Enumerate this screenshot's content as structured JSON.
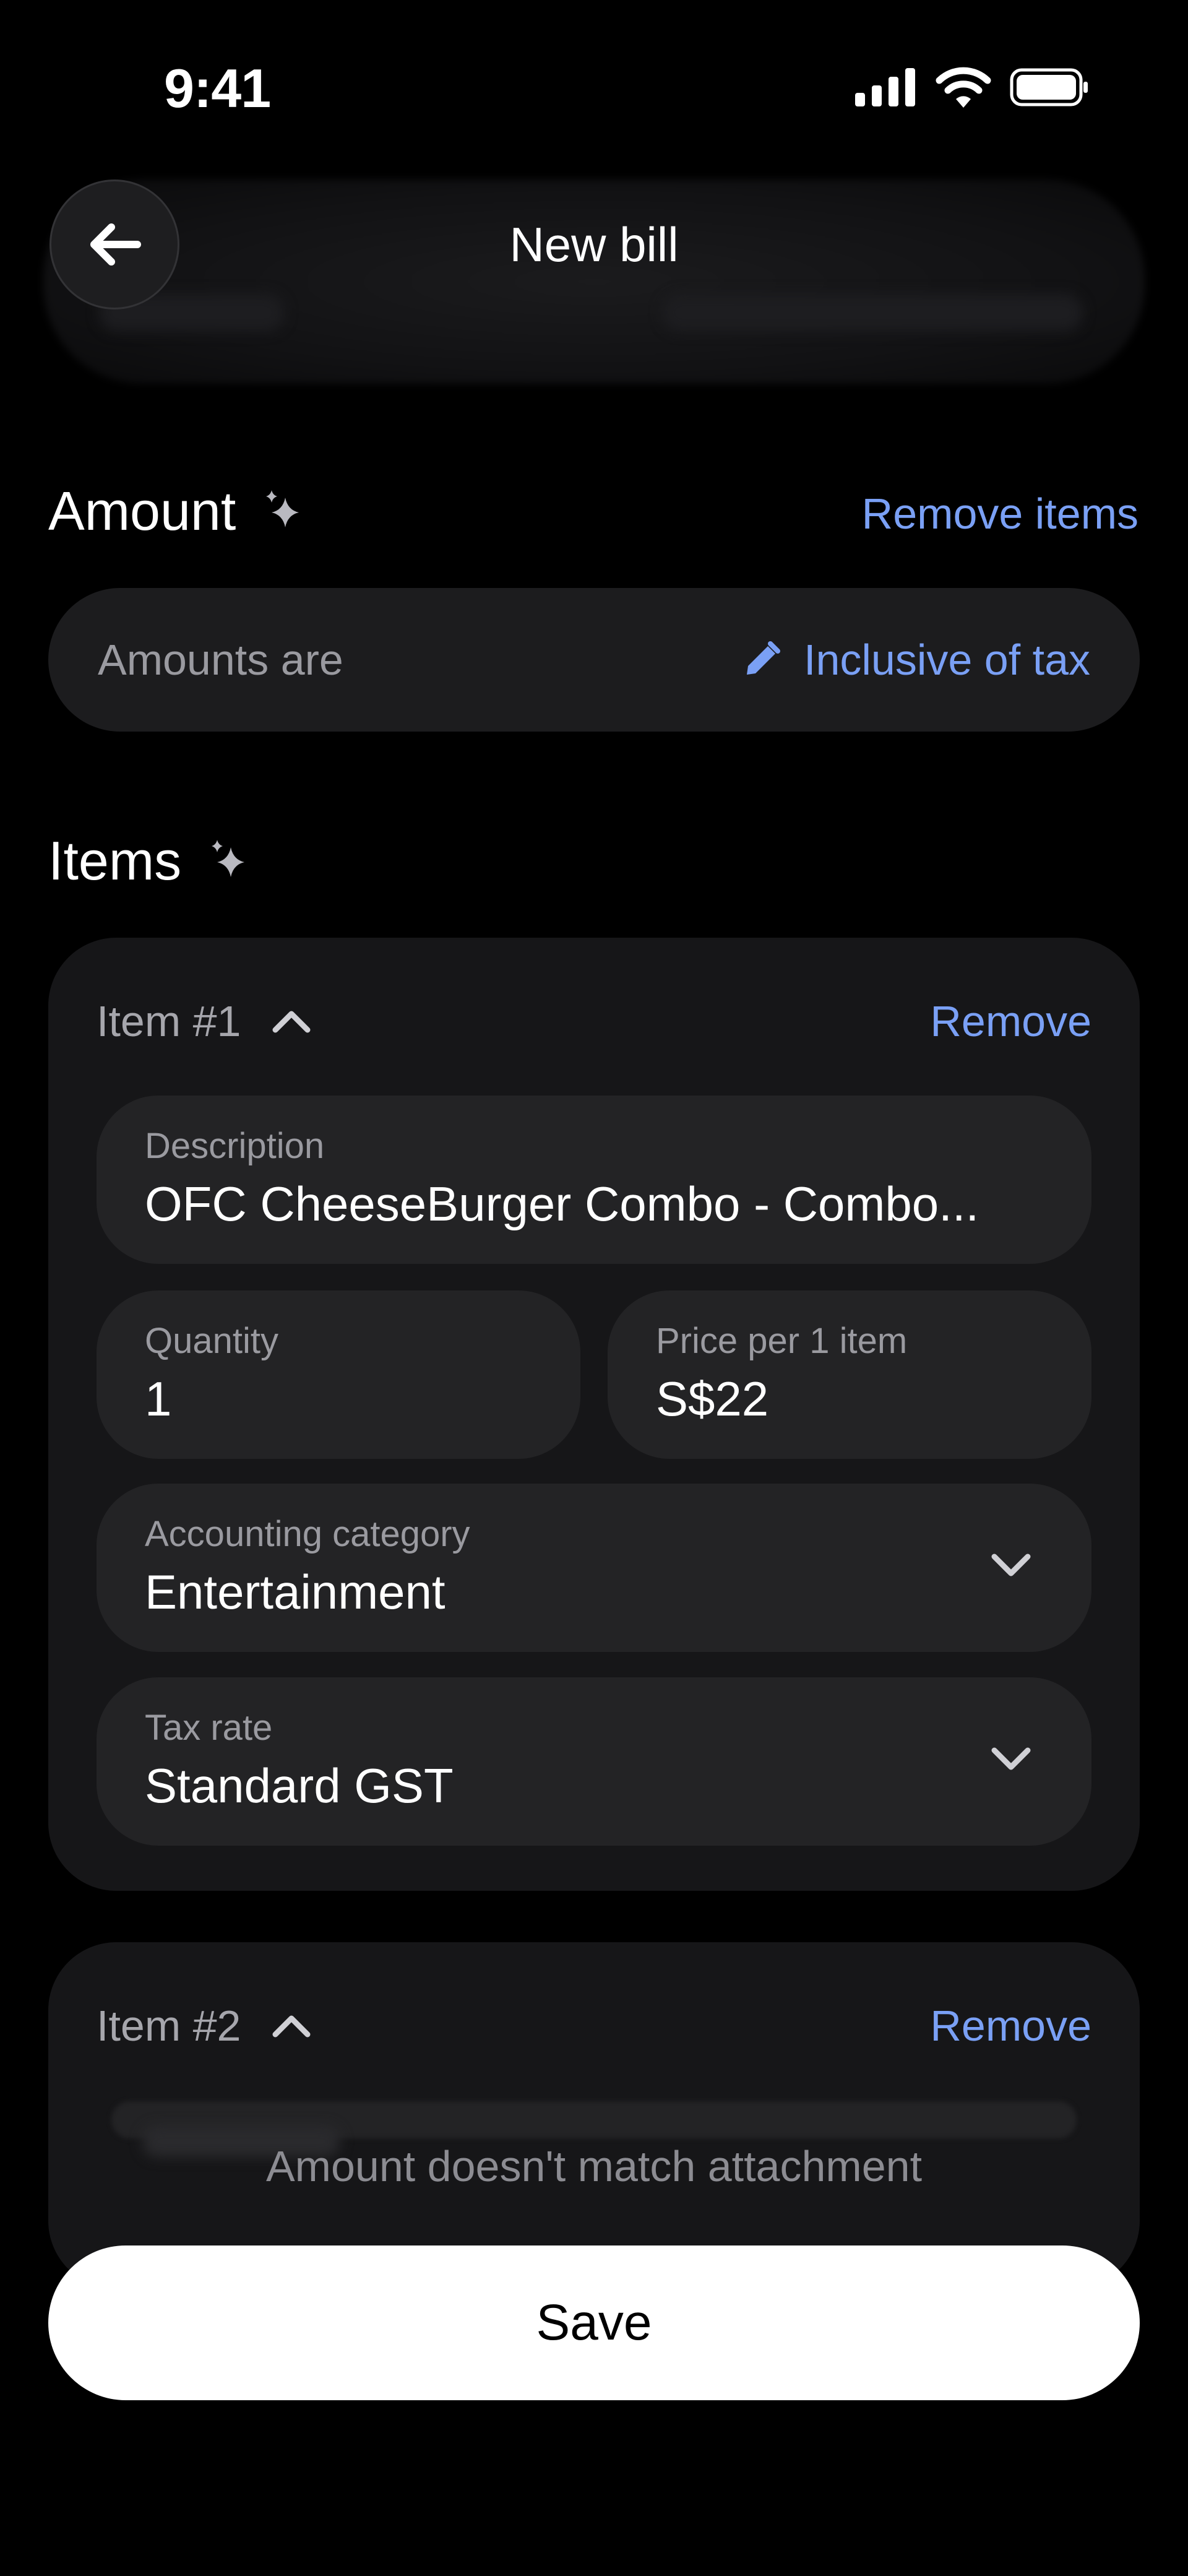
{
  "status_bar": {
    "time": "9:41"
  },
  "header": {
    "title": "New bill"
  },
  "amount": {
    "title": "Amount",
    "remove_items": "Remove items",
    "amounts_are_label": "Amounts are",
    "tax_mode": "Inclusive of tax"
  },
  "items_section": {
    "title": "Items"
  },
  "items": [
    {
      "title": "Item #1",
      "remove_label": "Remove",
      "description_label": "Description",
      "description_value": "OFC CheeseBurger Combo - Combo...",
      "quantity_label": "Quantity",
      "quantity_value": "1",
      "price_label": "Price per 1 item",
      "price_value": "S$22",
      "category_label": "Accounting category",
      "category_value": "Entertainment",
      "tax_label": "Tax rate",
      "tax_value": "Standard GST"
    },
    {
      "title": "Item #2",
      "remove_label": "Remove"
    }
  ],
  "warning": "Amount doesn't match attachment",
  "save_label": "Save",
  "colors": {
    "accent": "#7aa0f5",
    "background": "#000000",
    "card": "#161618",
    "field": "#232325"
  },
  "icons": [
    "back-arrow-icon",
    "sparkle-icon",
    "pencil-icon",
    "chevron-up-icon",
    "chevron-down-icon",
    "signal-icon",
    "wifi-icon",
    "battery-icon"
  ]
}
